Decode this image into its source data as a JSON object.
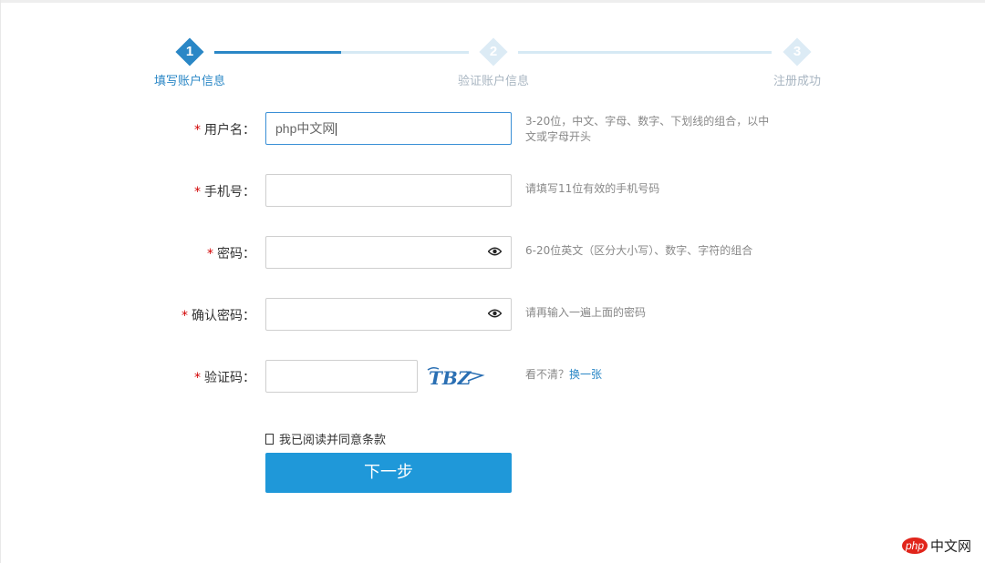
{
  "steps": [
    {
      "num": "1",
      "label": "填写账户信息",
      "state": "active"
    },
    {
      "num": "2",
      "label": "验证账户信息",
      "state": "inactive"
    },
    {
      "num": "3",
      "label": "注册成功",
      "state": "inactive"
    }
  ],
  "required_mark": "*",
  "form": {
    "username": {
      "label": "用户名：",
      "value": "php中文网",
      "hint": "3-20位，中文、字母、数字、下划线的组合，以中文或字母开头"
    },
    "phone": {
      "label": "手机号：",
      "value": "",
      "hint": "请填写11位有效的手机号码"
    },
    "password": {
      "label": "密码：",
      "value": "",
      "hint": "6-20位英文（区分大小写）、数字、字符的组合"
    },
    "confirm_password": {
      "label": "确认密码：",
      "value": "",
      "hint": "请再输入一遍上面的密码"
    },
    "captcha": {
      "label": "验证码：",
      "value": "",
      "image_text": "TBZ",
      "hint": "看不清？",
      "refresh_link": "换一张"
    }
  },
  "agree_text": "我已阅读并同意条款",
  "submit_label": "下一步",
  "brand": {
    "php": "php",
    "name": "中文网"
  },
  "colors": {
    "accent": "#2a87c6",
    "button": "#1f98d9",
    "required": "#d10000",
    "brand_red": "#e1251b"
  }
}
